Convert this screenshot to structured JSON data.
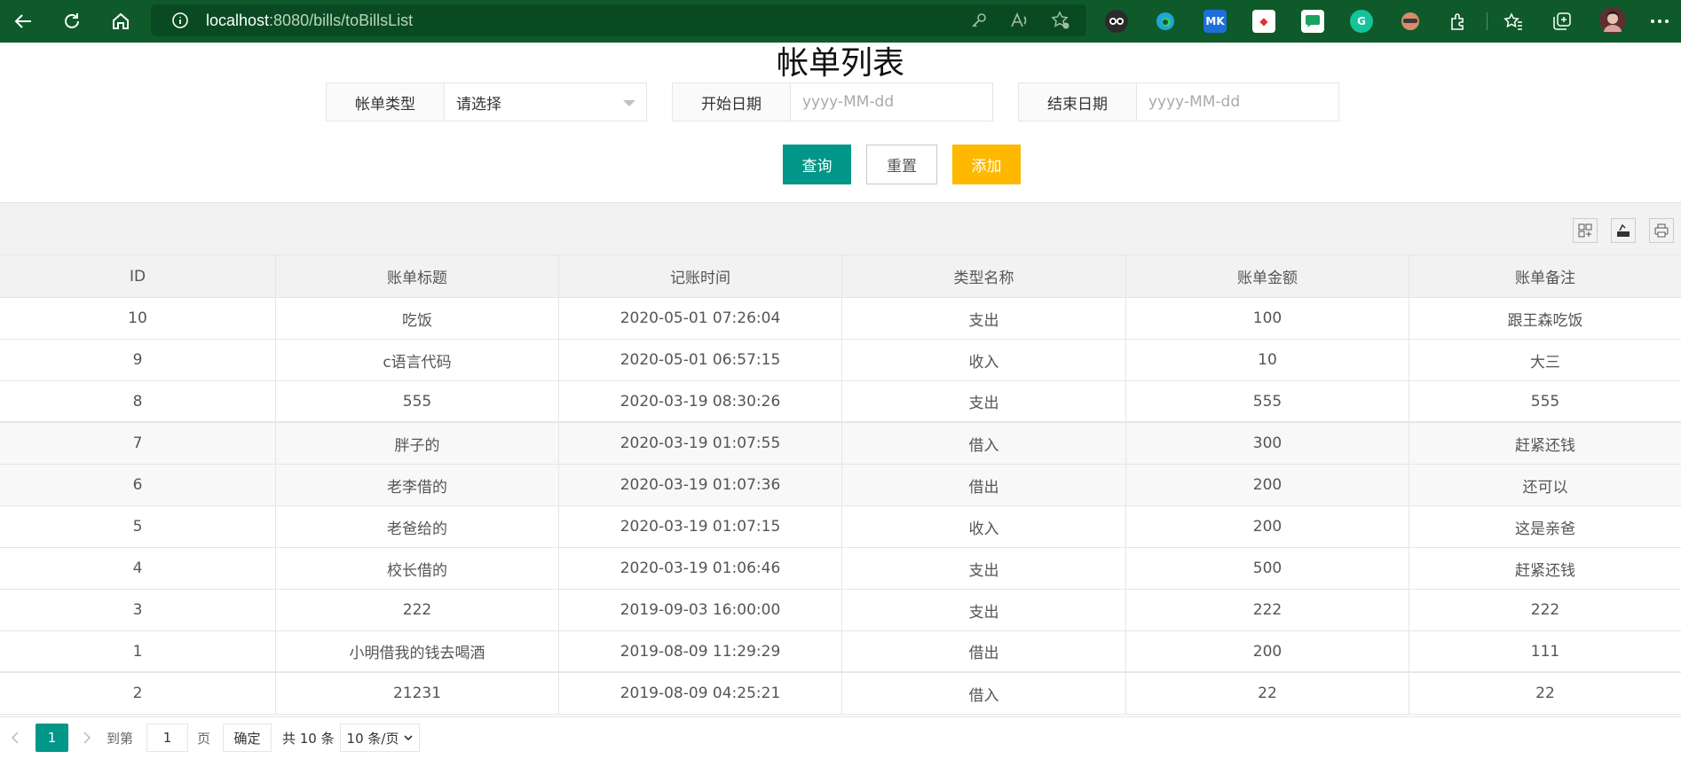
{
  "browser": {
    "url_host": "localhost",
    "url_rest": ":8080/bills/toBillsList"
  },
  "page": {
    "title": "帐单列表"
  },
  "filters": {
    "type_label": "帐单类型",
    "type_value": "请选择",
    "start_label": "开始日期",
    "start_placeholder": "yyyy-MM-dd",
    "end_label": "结束日期",
    "end_placeholder": "yyyy-MM-dd"
  },
  "actions": {
    "query": "查询",
    "reset": "重置",
    "add": "添加"
  },
  "table": {
    "headers": [
      "ID",
      "账单标题",
      "记账时间",
      "类型名称",
      "账单金额",
      "账单备注"
    ],
    "rows": [
      [
        "10",
        "吃饭",
        "2020-05-01 07:26:04",
        "支出",
        "100",
        "跟王森吃饭"
      ],
      [
        "9",
        "c语言代码",
        "2020-05-01 06:57:15",
        "收入",
        "10",
        "大三"
      ],
      [
        "8",
        "555",
        "2020-03-19 08:30:26",
        "支出",
        "555",
        "555"
      ],
      [
        "7",
        "胖子的",
        "2020-03-19 01:07:55",
        "借入",
        "300",
        "赶紧还钱"
      ],
      [
        "6",
        "老李借的",
        "2020-03-19 01:07:36",
        "借出",
        "200",
        "还可以"
      ],
      [
        "5",
        "老爸给的",
        "2020-03-19 01:07:15",
        "收入",
        "200",
        "这是亲爸"
      ],
      [
        "4",
        "校长借的",
        "2020-03-19 01:06:46",
        "支出",
        "500",
        "赶紧还钱"
      ],
      [
        "3",
        "222",
        "2019-09-03 16:00:00",
        "支出",
        "222",
        "222"
      ],
      [
        "1",
        "小明借我的钱去喝酒",
        "2019-08-09 11:29:29",
        "借出",
        "200",
        "111"
      ],
      [
        "2",
        "21231",
        "2019-08-09 04:25:21",
        "借入",
        "22",
        "22"
      ]
    ]
  },
  "pager": {
    "current": "1",
    "goto_label": "到第",
    "goto_value": "1",
    "page_label": "页",
    "confirm": "确定",
    "total": "共 10 条",
    "per_page": "10 条/页"
  }
}
